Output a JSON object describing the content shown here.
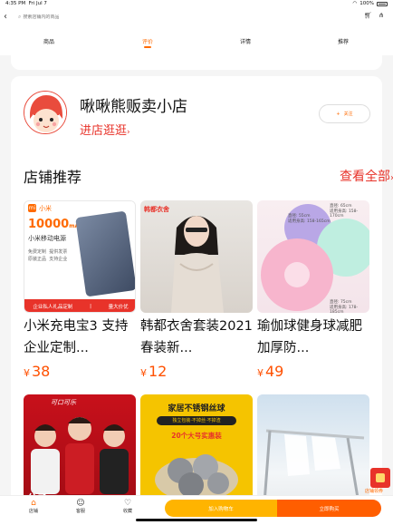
{
  "status_bar": {
    "time": "4:35 PM",
    "date": "Fri Jul 7",
    "battery": "100%"
  },
  "search": {
    "placeholder": "搜索店铺内的商品"
  },
  "tabs": [
    {
      "label": "商品"
    },
    {
      "label": "评价"
    },
    {
      "label": "详情"
    },
    {
      "label": "推荐"
    }
  ],
  "active_tab": "评价",
  "shop": {
    "name": "啾啾熊贩卖小店",
    "enter_label": "进店逛逛",
    "follow_label": "关注"
  },
  "recommend": {
    "title": "店铺推荐",
    "view_all": "查看全部"
  },
  "products": [
    {
      "title": "小米充电宝3 支持企业定制...",
      "price": "38",
      "currency": "¥",
      "image_text": {
        "brand": "小米",
        "capacity": "10000",
        "unit": "mAh",
        "name": "小米移动电源",
        "feat1": "免费定制",
        "feat2": "提供发票",
        "feat3": "原装正品",
        "feat4": "支持企业",
        "banner_left": "企业私人礼品定制",
        "banner_right": "量大价优"
      }
    },
    {
      "title": "韩都衣舍套装2021春装新...",
      "price": "12",
      "currency": "¥",
      "image_text": {
        "brand": "韩都衣舍"
      }
    },
    {
      "title": "瑜伽球健身球减肥加厚防...",
      "price": "49",
      "currency": "¥",
      "image_text": {
        "d1": "直径: 65cm",
        "d1_sub": "适用身高: 158-170cm",
        "d2": "直径: 55cm",
        "d2_sub": "适用身高: 158-165cm",
        "d3": "直径: 75cm",
        "d3_sub": "适用身高: 178-185cm"
      }
    },
    {
      "title": "",
      "price": "",
      "currency": "",
      "image_text": {
        "logo": "可口可乐",
        "promo": "分子"
      }
    },
    {
      "title": "",
      "price": "",
      "currency": "",
      "image_text": {
        "line1": "家居不锈钢丝球",
        "line2": "独立包装·不掉丝·不掉渣",
        "line3": "20个大号实惠装"
      }
    },
    {
      "title": "",
      "price": "",
      "currency": "",
      "image_text": {}
    }
  ],
  "floating_badge": {
    "label": "店铺领券"
  },
  "bottom_bar": {
    "shop": "店铺",
    "service": "客服",
    "favorite": "收藏",
    "add_to_cart": "加入购物车",
    "buy_now": "立即购买"
  },
  "colors": {
    "accent": "#ff6a00",
    "red": "#e8332a",
    "cart": "#ffb400",
    "buy": "#ff5e00"
  }
}
